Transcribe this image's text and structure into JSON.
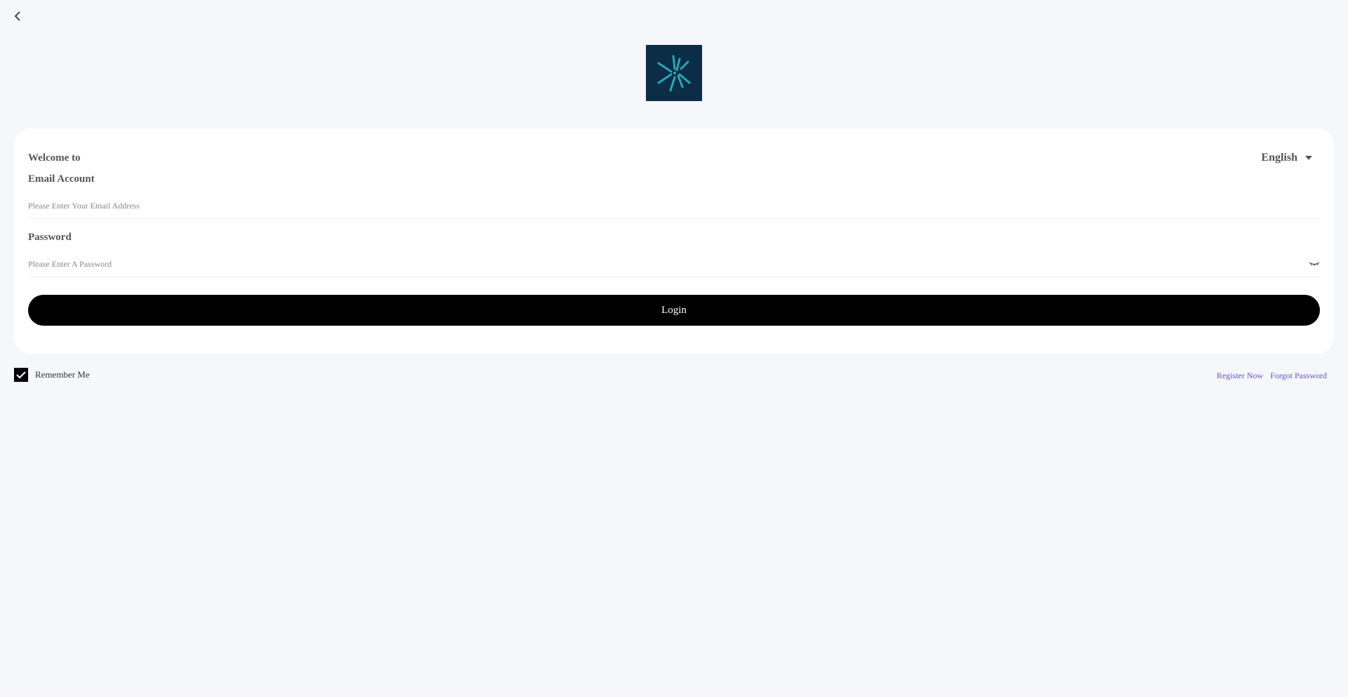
{
  "header": {
    "back_icon": "chevron-left-icon",
    "logo_icon": "asterisk-logo-icon"
  },
  "login_card": {
    "welcome_text": "Welcome to",
    "language": {
      "selected": "English",
      "icon": "caret-down-icon"
    },
    "email": {
      "label": "Email Account",
      "value": "",
      "placeholder": "Please Enter Your Email Address"
    },
    "password": {
      "label": "Password",
      "value": "",
      "placeholder": "Please Enter A Password",
      "toggle_icon": "eye-closed-icon"
    },
    "login_label": "Login"
  },
  "footer": {
    "remember_me_label": "Remember Me",
    "remember_me_checked": true,
    "register_label": "Register Now",
    "forgot_label": "Forgot Password"
  },
  "colors": {
    "background": "#f5f7fa",
    "card": "#ffffff",
    "logo_bg": "#0b2d45",
    "logo_accent": "#2aa7b8",
    "button": "#000000",
    "link": "#6a4fc1"
  }
}
